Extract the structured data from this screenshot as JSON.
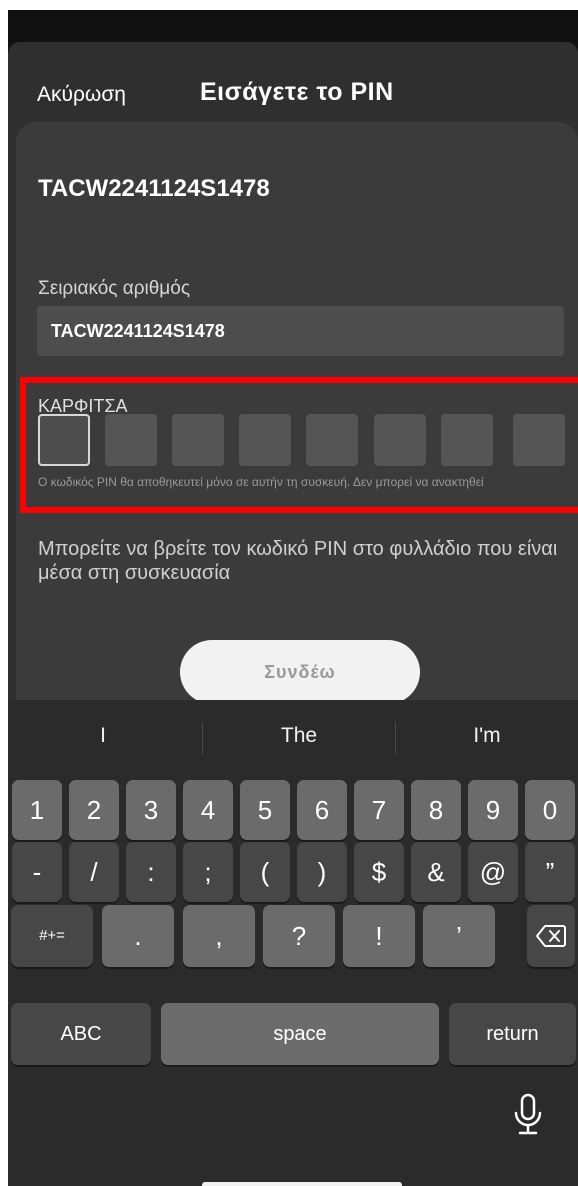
{
  "nav": {
    "cancel_label": "Ακύρωση",
    "title": "Εισάγετε το PIN"
  },
  "device": {
    "id": "TACW2241124S1478"
  },
  "serial": {
    "label": "Σειριακός αριθμός",
    "value": "TACW2241124S1478"
  },
  "pin": {
    "label": "ΚΑΡΦΙΤΣΑ",
    "box_count": 8,
    "entered": "",
    "note": "Ο κωδικός PIN θα αποθηκευτεί μόνο σε αυτήν τη συσκευή. Δεν μπορεί να ανακτηθεί"
  },
  "info": "Μπορείτε να βρείτε τον κωδικό PIN στο φυλλάδιο που είναι μέσα στη συσκευασία",
  "connect_label": "Συνδέω",
  "keyboard": {
    "suggestions": [
      "I",
      "The",
      "I'm"
    ],
    "row1": [
      "1",
      "2",
      "3",
      "4",
      "5",
      "6",
      "7",
      "8",
      "9",
      "0"
    ],
    "row2": [
      "-",
      "/",
      ":",
      ";",
      "(",
      ")",
      "$",
      "&",
      "@",
      "”"
    ],
    "row3": {
      "shift": "#+=",
      "keys": [
        ".",
        ",",
        "?",
        "!",
        "’"
      ]
    },
    "row4": {
      "abc": "ABC",
      "space": "space",
      "return": "return"
    }
  },
  "colors": {
    "highlight": "#ff0000",
    "sheet": "#2f2f2f",
    "card": "#3b3b3b"
  },
  "icons": {
    "backspace": "backspace-icon",
    "mic": "microphone-icon"
  }
}
